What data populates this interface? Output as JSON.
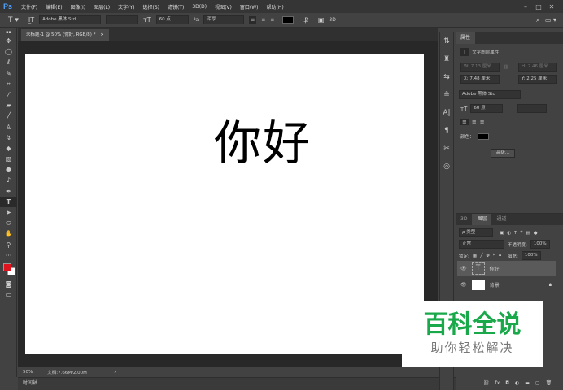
{
  "menubar": {
    "logo": "Ps",
    "items": [
      "文件(F)",
      "编辑(E)",
      "图像(I)",
      "图层(L)",
      "文字(Y)",
      "选择(S)",
      "滤镜(T)",
      "3D(D)",
      "视图(V)",
      "窗口(W)",
      "帮助(H)"
    ],
    "minimize": "–",
    "maximize": "□",
    "close": "✕"
  },
  "options": {
    "font_family": "Adobe 黑体 Std",
    "font_size": "60 点",
    "aa_label": "ªa",
    "antialias": "浑厚",
    "color": "#000000",
    "threed": "3D"
  },
  "document": {
    "tab_title": "未标题-1 @ 50% (你好, RGB/8) *",
    "tab_close": "×",
    "text": "你好"
  },
  "status": {
    "zoom": "50%",
    "doc_info": "文档:7.66M/2.00M",
    "arrow": "›"
  },
  "timeline": {
    "label": "时间轴"
  },
  "properties": {
    "tab": "属性",
    "type_label": "文字图层属性",
    "w": "W: 7.13 厘米",
    "h": "H: 2.46 厘米",
    "x": "X: 7.48 厘米",
    "y": "Y: 2.25 厘米",
    "font": "Adobe 黑体 Std",
    "size": "60 点",
    "color_label": "颜色：",
    "color": "#000000",
    "advanced": "高级..."
  },
  "layers": {
    "tabs": [
      "3D",
      "图层",
      "通道"
    ],
    "filter": "ρ 类型",
    "blend": "正常",
    "opacity_label": "不透明度:",
    "opacity": "100%",
    "lock_label": "锁定:",
    "fill_label": "填充:",
    "fill": "100%",
    "items": [
      {
        "name": "你好",
        "thumb": "T"
      },
      {
        "name": "背景",
        "thumb": ""
      }
    ]
  },
  "watermark": {
    "line1": "百科全说",
    "line2": "助你轻松解决"
  }
}
